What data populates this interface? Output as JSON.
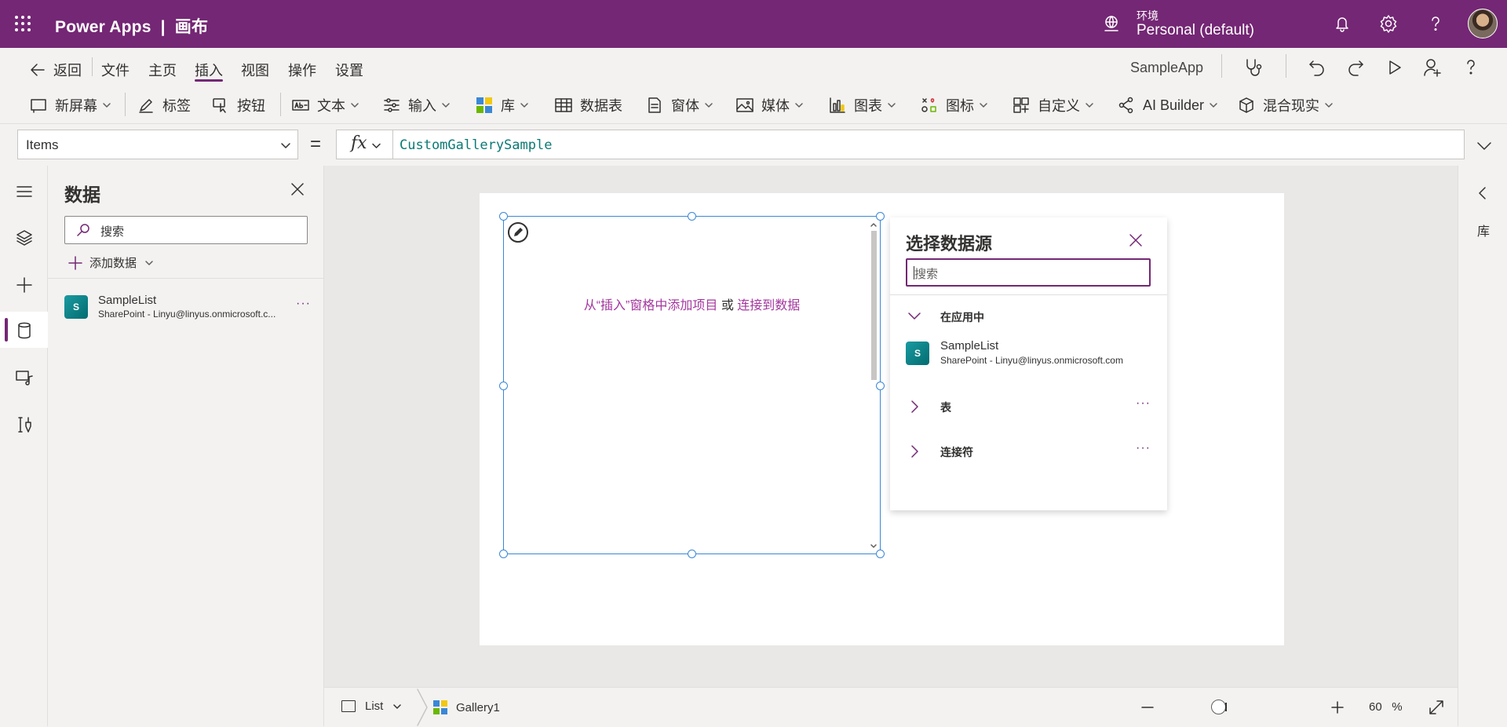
{
  "header": {
    "app_title": "Power Apps  |  画布",
    "env_label": "环境",
    "env_name": "Personal (default)"
  },
  "menu": {
    "back": "返回",
    "items": [
      "文件",
      "主页",
      "插入",
      "视图",
      "操作",
      "设置"
    ],
    "active_item": "插入",
    "app_name": "SampleApp"
  },
  "ribbon": {
    "items": [
      {
        "label": "新屏幕",
        "icon": "new-screen-icon",
        "dropdown": true
      },
      {
        "label": "标签",
        "icon": "label-icon",
        "dropdown": false
      },
      {
        "label": "按钮",
        "icon": "button-icon",
        "dropdown": false
      },
      {
        "label": "文本",
        "icon": "text-icon",
        "dropdown": true
      },
      {
        "label": "输入",
        "icon": "input-icon",
        "dropdown": true
      },
      {
        "label": "库",
        "icon": "gallery-icon",
        "dropdown": true
      },
      {
        "label": "数据表",
        "icon": "data-table-icon",
        "dropdown": false
      },
      {
        "label": "窗体",
        "icon": "form-icon",
        "dropdown": true
      },
      {
        "label": "媒体",
        "icon": "media-icon",
        "dropdown": true
      },
      {
        "label": "图表",
        "icon": "chart-icon",
        "dropdown": true
      },
      {
        "label": "图标",
        "icon": "icons-icon",
        "dropdown": true
      },
      {
        "label": "自定义",
        "icon": "custom-icon",
        "dropdown": true
      },
      {
        "label": "AI Builder",
        "icon": "ai-builder-icon",
        "dropdown": true
      },
      {
        "label": "混合现实",
        "icon": "mixed-reality-icon",
        "dropdown": true
      }
    ]
  },
  "formula": {
    "property": "Items",
    "equals": "=",
    "fx": "fx",
    "value": "CustomGallerySample"
  },
  "data_panel": {
    "title": "数据",
    "search_placeholder": "搜索",
    "add_data": "添加数据",
    "sources": [
      {
        "name": "SampleList",
        "subtitle": "SharePoint - Linyu@linyus.onmicrosoft.c...",
        "logo": "S"
      }
    ],
    "more": "···"
  },
  "canvas": {
    "hint_prefix": "从“插入”窗格中添加项目",
    "hint_or": " 或 ",
    "hint_link": "连接到数据"
  },
  "data_source_popup": {
    "title": "选择数据源",
    "search_placeholder": "搜索",
    "section_in_app": "在应用中",
    "item_name": "SampleList",
    "item_subtitle": "SharePoint - Linyu@linyus.onmicrosoft.com",
    "section_tables": "表",
    "section_connectors": "连接符",
    "more": "···"
  },
  "right_rail": {
    "label": "库"
  },
  "status": {
    "screen_type": "List",
    "selected_control": "Gallery1",
    "zoom_value": "60",
    "zoom_unit": "%"
  },
  "colors": {
    "brand_purple": "#742774",
    "link_magenta": "#a4379f",
    "selection_blue": "#3a87d6",
    "formula_teal": "#0b7a75"
  }
}
